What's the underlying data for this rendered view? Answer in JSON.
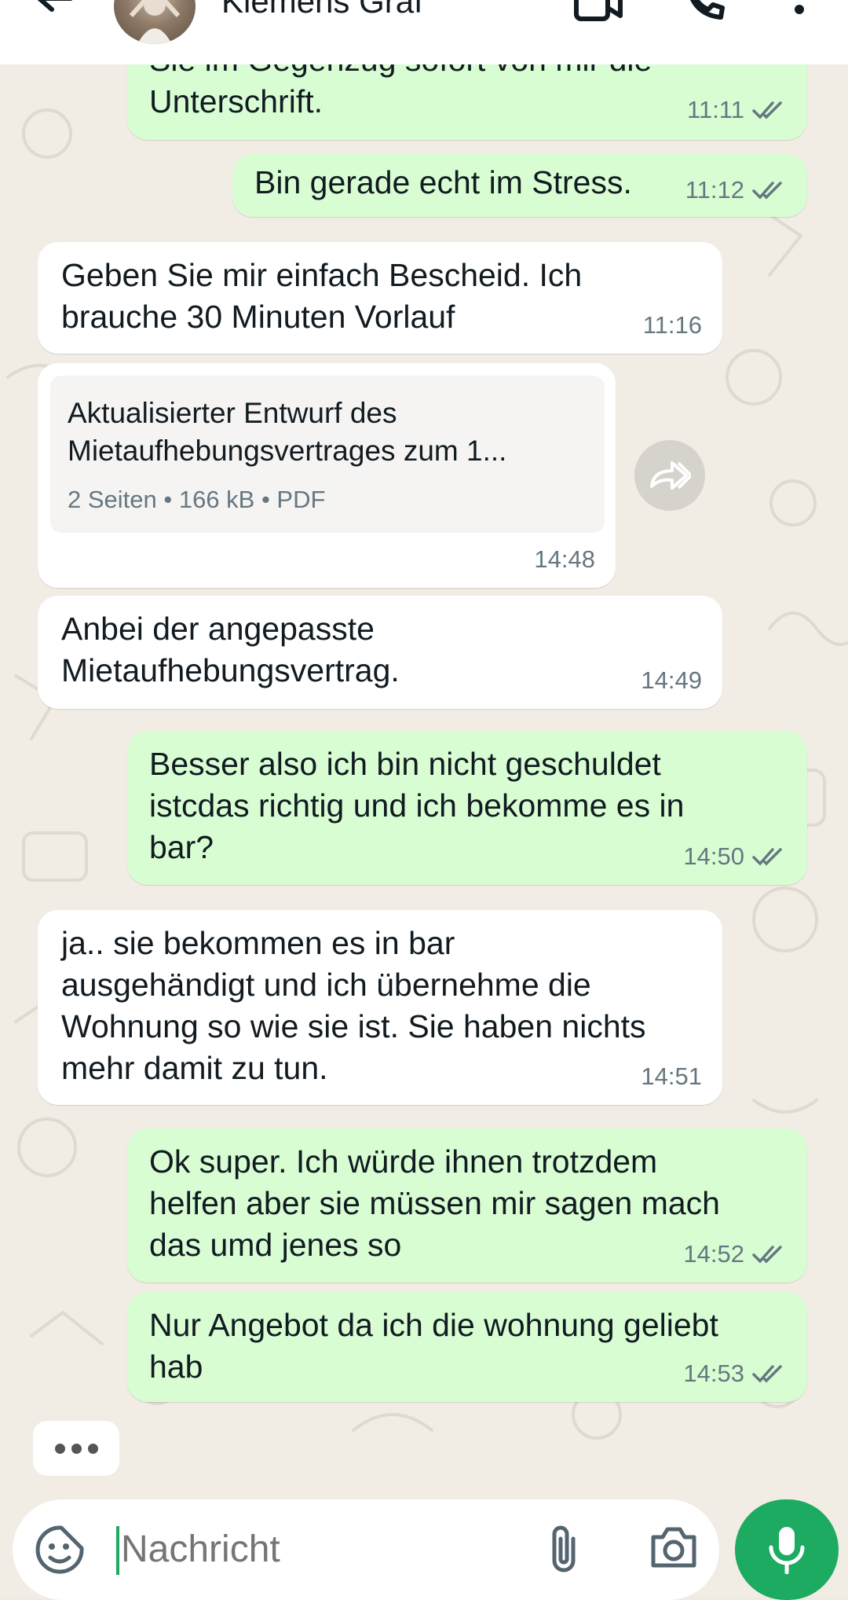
{
  "header": {
    "contact_name": "Klemens Graf"
  },
  "messages": [
    {
      "dir": "out",
      "text": "Sie im Gegenzug sofort von mir die\nUnterschrift.",
      "time": "11:11",
      "status": "read"
    },
    {
      "dir": "out",
      "text": "Bin gerade echt im Stress.",
      "time": "11:12",
      "status": "read"
    },
    {
      "dir": "in",
      "text": "Geben Sie mir einfach Bescheid.  Ich\nbrauche 30 Minuten Vorlauf",
      "time": "11:16"
    },
    {
      "dir": "in",
      "type": "document",
      "doc_title": "Aktualisierter Entwurf des\nMietaufhebungsvertrages zum 1...",
      "doc_info": "2 Seiten • 166 kB • PDF",
      "time": "14:48"
    },
    {
      "dir": "in",
      "text": "Anbei der angepasste\nMietaufhebungsvertrag.",
      "time": "14:49"
    },
    {
      "dir": "out",
      "text": "Besser also ich bin nicht geschuldet\nistcdas richtig und ich bekomme es in\nbar?",
      "time": "14:50",
      "status": "read"
    },
    {
      "dir": "in",
      "text": "ja.. sie bekommen es in bar\nausgehändigt und ich übernehme die\nWohnung so wie sie ist. Sie haben nichts\nmehr damit zu tun.",
      "time": "14:51"
    },
    {
      "dir": "out",
      "text": "Ok super. Ich würde ihnen trotzdem\nhelfen aber sie müssen mir sagen mach\ndas umd jenes so",
      "time": "14:52",
      "status": "read"
    },
    {
      "dir": "out",
      "text": "Nur Angebot da ich die wohnung geliebt\nhab",
      "time": "14:53",
      "status": "read"
    }
  ],
  "composer": {
    "placeholder": "Nachricht"
  },
  "icons": {
    "back": "arrow-left-icon",
    "video": "video-call-icon",
    "call": "phone-icon",
    "menu": "more-vertical-icon",
    "emoji": "sticker-smiley-icon",
    "attach": "paperclip-icon",
    "camera": "camera-icon",
    "mic": "microphone-icon",
    "forward": "forward-icon",
    "read_receipt": "double-check-icon"
  },
  "colors": {
    "outgoing_bubble": "#d9fdd3",
    "incoming_bubble": "#ffffff",
    "accent": "#1daa61",
    "read_tick": "#53bdeb"
  }
}
